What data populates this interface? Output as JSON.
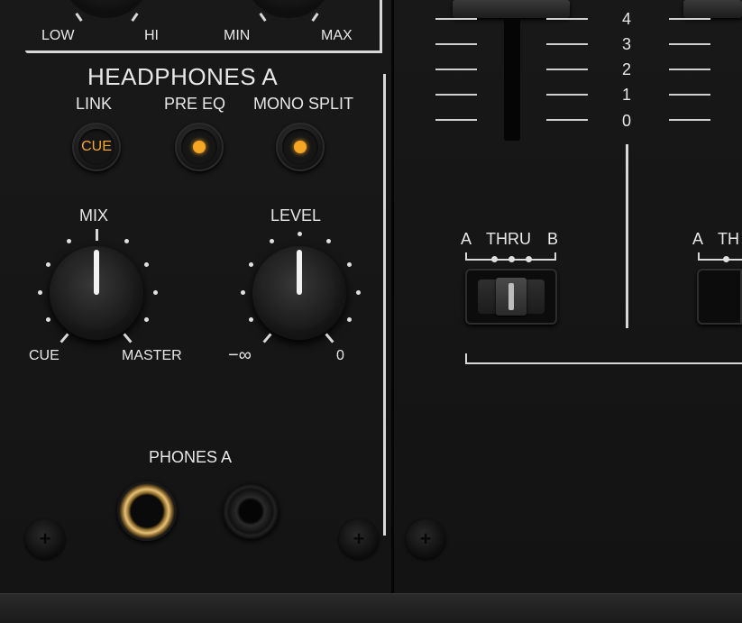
{
  "eq_knobs": {
    "low_label": "LOW",
    "hi_label": "HI",
    "min_label": "MIN",
    "max_label": "MAX"
  },
  "headphones": {
    "title": "HEADPHONES A",
    "buttons": {
      "link_label": "LINK",
      "link_button_text": "CUE",
      "pre_eq_label": "PRE EQ",
      "mono_split_label": "MONO SPLIT"
    },
    "mix": {
      "label": "MIX",
      "left_label": "CUE",
      "right_label": "MASTER"
    },
    "level": {
      "label": "LEVEL",
      "left_label": "−∞",
      "right_label": "0"
    },
    "phones_label": "PHONES A"
  },
  "channel_fader": {
    "scale": [
      "4",
      "3",
      "2",
      "1",
      "0"
    ]
  },
  "crossfader_assign": {
    "left": "A",
    "center": "THRU",
    "right": "B",
    "partial_left": "A",
    "partial_center": "TH"
  },
  "colors": {
    "accent_led": "#f5a623",
    "panel": "#161616"
  },
  "icons": {
    "screw": "screw-icon",
    "jack": "phones-jack-icon"
  }
}
